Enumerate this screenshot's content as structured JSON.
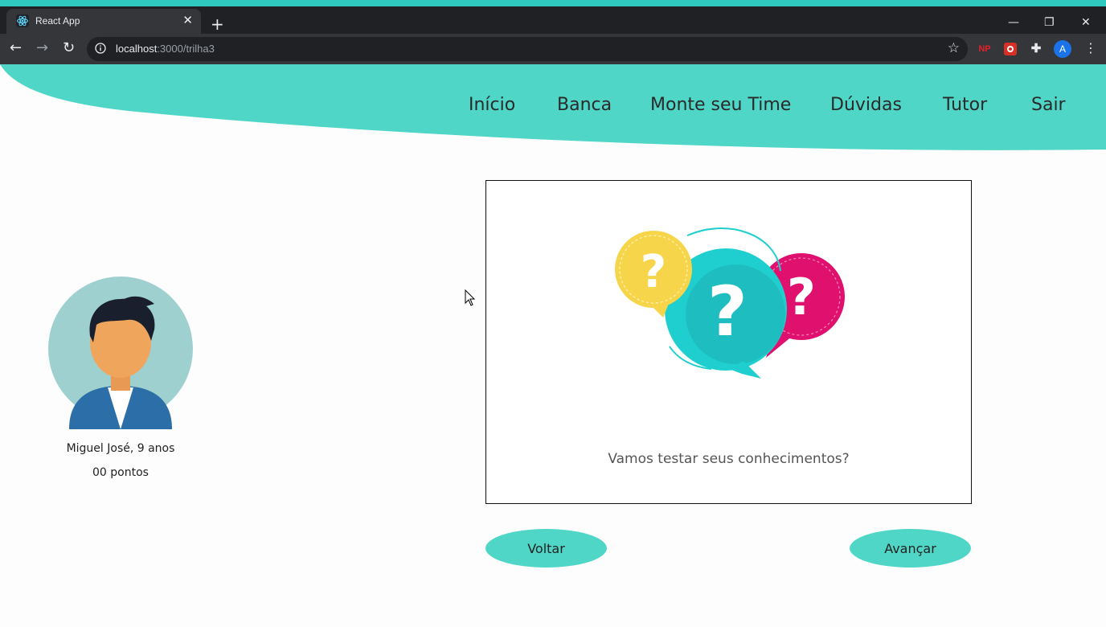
{
  "browser": {
    "tab_title": "React App",
    "tab_close": "✕",
    "new_tab": "+",
    "url_host": "localhost",
    "url_path": ":3000/trilha3",
    "ext_np": "NP",
    "profile_initial": "A",
    "win_minimize": "—",
    "win_restore": "❐",
    "win_close": "✕"
  },
  "nav": {
    "items": [
      "Início",
      "Banca",
      "Monte seu Time",
      "Dúvidas",
      "Tutor",
      "Sair"
    ]
  },
  "profile": {
    "name": "Miguel José, 9 anos",
    "points": "00 pontos"
  },
  "card": {
    "text": "Vamos testar seus conhecimentos?"
  },
  "buttons": {
    "back": "Voltar",
    "next": "Avançar"
  },
  "colors": {
    "accent": "#4fd6c6",
    "yellow": "#f7d54a",
    "teal": "#1fcfcf",
    "magenta": "#e0106e"
  }
}
